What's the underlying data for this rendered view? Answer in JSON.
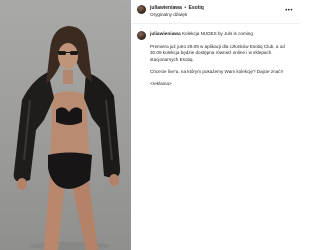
{
  "post": {
    "username": "juliawieniawa",
    "separator": "•",
    "brand": "Esotiq",
    "audio": "Oryginalny dźwięk",
    "more_icon": "more-horizontal-icon"
  },
  "caption": {
    "username": "juliawieniawa",
    "headline": " Kolekcja NUDES by Juls is coming ",
    "paragraph1": "Premiera już jutro 29.09 w aplikacji dla członków Esotiq Club, a od 30.09 kolekcja będzie dostępna również online i w sklepach stacjonarnych Esotiq.",
    "paragraph2": "Chcecie live’a, na którym pokażemy Wam kolekcję? Dajcie znać!!",
    "paragraph3": "<reklama>"
  },
  "colors": {
    "photo_background": "#9f9f9d",
    "jacket": "#1d1b1a",
    "skin": "#b68a70",
    "text": "#262626"
  }
}
